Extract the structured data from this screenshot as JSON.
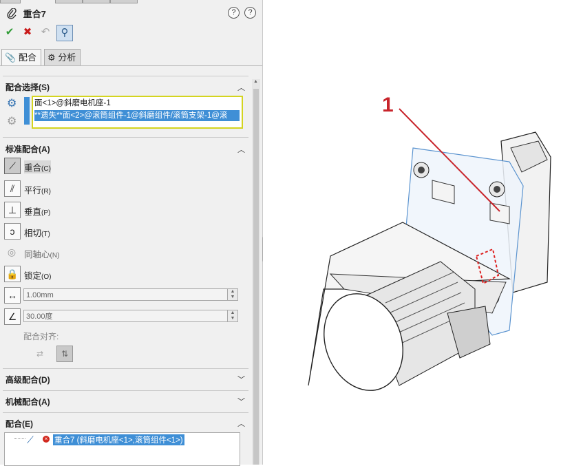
{
  "header": {
    "title": "重合7",
    "help_icons": [
      "pin-help-icon",
      "help-icon"
    ]
  },
  "toolbar": {
    "buttons": [
      "ok-check-icon",
      "cancel-x-icon",
      "undo-icon",
      "pushpin-icon"
    ]
  },
  "tabs": [
    {
      "label": "配合",
      "active": true
    },
    {
      "label": "分析",
      "active": false
    }
  ],
  "mate_selections": {
    "title": "配合选择(S)",
    "items": [
      "面<1>@斜磨电机座-1",
      "**遗失**面<2>@滚筒组件-1@斜磨组件/滚筒支架-1@滚"
    ]
  },
  "standard_mates": {
    "title": "标准配合(A)",
    "items": [
      {
        "label": "重合",
        "key": "(C)",
        "selected": true,
        "icon": "coincident-icon"
      },
      {
        "label": "平行",
        "key": "(R)",
        "selected": false,
        "icon": "parallel-icon"
      },
      {
        "label": "垂直",
        "key": "(P)",
        "selected": false,
        "icon": "perpendicular-icon"
      },
      {
        "label": "相切",
        "key": "(T)",
        "selected": false,
        "icon": "tangent-icon"
      },
      {
        "label": "同轴心",
        "key": "(N)",
        "selected": false,
        "icon": "concentric-icon"
      },
      {
        "label": "锁定",
        "key": "(O)",
        "selected": false,
        "icon": "lock-icon"
      }
    ],
    "distance": "1.00mm",
    "angle": "30.00度",
    "alignment_label": "配合对齐:"
  },
  "collapsed_sections": [
    {
      "title": "高级配合(D)"
    },
    {
      "title": "机械配合(A)"
    }
  ],
  "mates": {
    "title": "配合(E)",
    "entry": "重合7 (斜磨电机座<1>,滚筒组件<1>)"
  },
  "viewport": {
    "callout_label": "1",
    "callout_color": "#c8242b"
  }
}
